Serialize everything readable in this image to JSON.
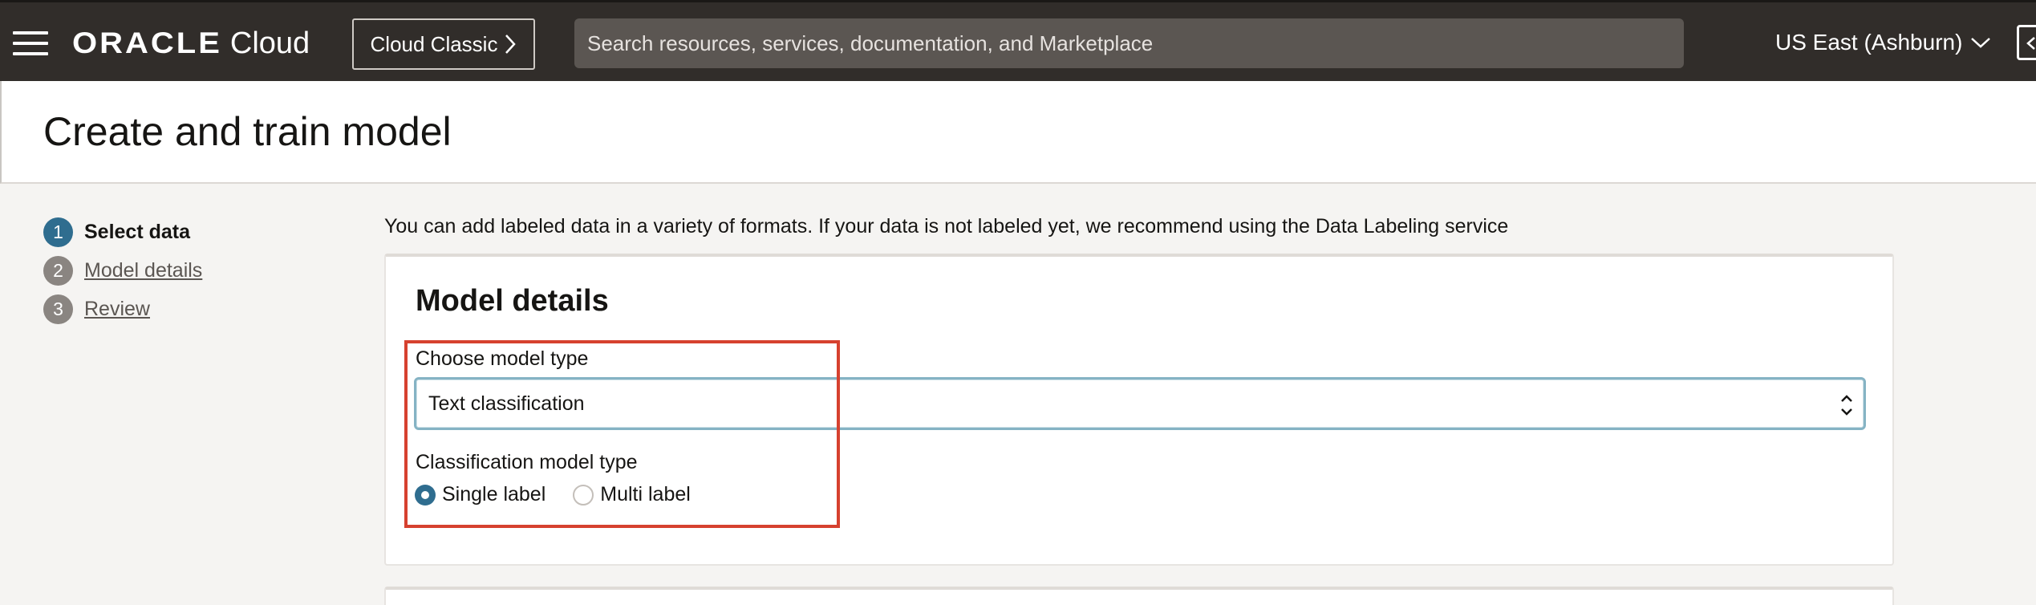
{
  "topbar": {
    "menu_icon": "hamburger-menu-icon",
    "logo_text": "ORACLE",
    "logo_suffix": "Cloud",
    "classic_button_label": "Cloud Classic",
    "search_placeholder": "Search resources, services, documentation, and Marketplace",
    "region_label": "US East (Ashburn)",
    "panel_icon": "collapse-panel-icon"
  },
  "page": {
    "title": "Create and train model"
  },
  "steps": [
    {
      "number": "1",
      "label": "Select data",
      "state": "active"
    },
    {
      "number": "2",
      "label": "Model details",
      "state": "link"
    },
    {
      "number": "3",
      "label": "Review",
      "state": "link"
    }
  ],
  "info_text": "You can add labeled data in a variety of formats. If your data is not labeled yet, we recommend using the Data Labeling service",
  "model_details": {
    "title": "Model details",
    "model_type_label": "Choose model type",
    "model_type_value": "Text classification",
    "classification_label": "Classification model type",
    "options": [
      {
        "label": "Single label",
        "checked": true
      },
      {
        "label": "Multi label",
        "checked": false
      }
    ]
  },
  "colors": {
    "topbar": "#312d2a",
    "accent": "#2f6d8f",
    "highlight": "#d6412f"
  }
}
